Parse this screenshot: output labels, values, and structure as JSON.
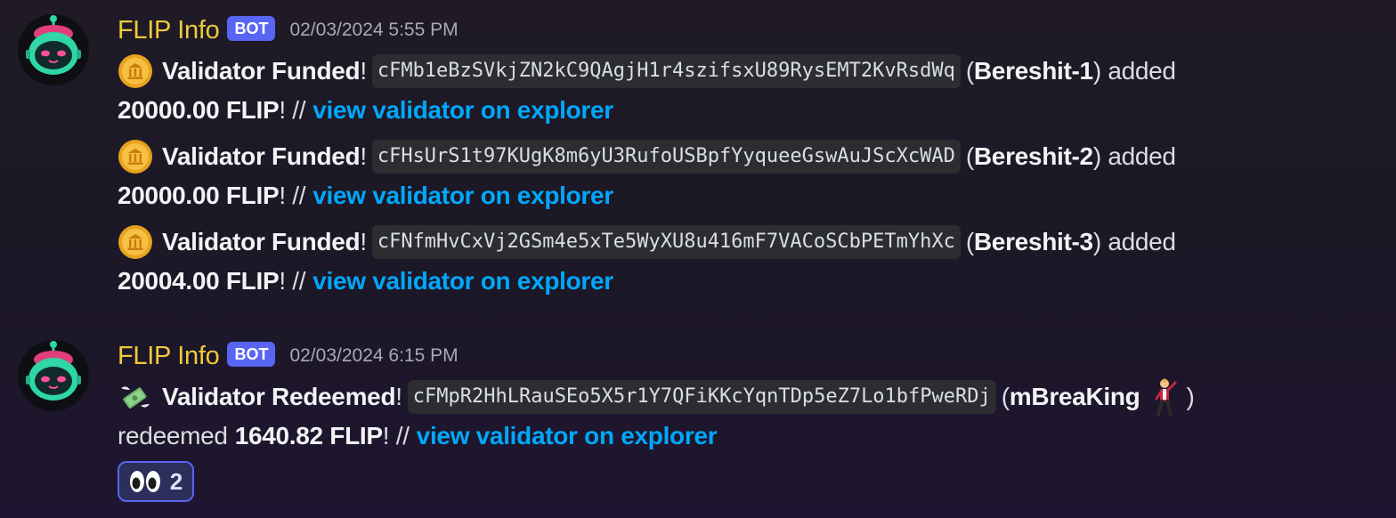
{
  "messages": [
    {
      "author": "FLIP Info",
      "bot_tag": "BOT",
      "timestamp": "02/03/2024 5:55 PM",
      "avatar_icon": "robot-avatar-icon",
      "entries": [
        {
          "icon": "coin-emoji-icon",
          "title": "Validator Funded",
          "bang": "!",
          "address": "cFMb1eBzSVkjZN2kC9QAgjH1r4szifsxU89RysEMT2KvRsdWq",
          "open_paren": "(",
          "name": "Bereshit-1",
          "close_text": ") added",
          "amount": "20000.00 FLIP",
          "sep": "! //",
          "link": "view validator on explorer"
        },
        {
          "icon": "coin-emoji-icon",
          "title": "Validator Funded",
          "bang": "!",
          "address": "cFHsUrS1t97KUgK8m6yU3RufoUSBpfYyqueeGswAuJScXcWAD",
          "open_paren": "(",
          "name": "Bereshit-2",
          "close_text": ") added",
          "amount": "20000.00 FLIP",
          "sep": "! //",
          "link": "view validator on explorer"
        },
        {
          "icon": "coin-emoji-icon",
          "title": "Validator Funded",
          "bang": "!",
          "address": "cFNfmHvCxVj2GSm4e5xTe5WyXU8u416mF7VACoSCbPETmYhXc",
          "open_paren": "(",
          "name": "Bereshit-3",
          "close_text": ") added",
          "amount": "20004.00 FLIP",
          "sep": "! //",
          "link": "view validator on explorer"
        }
      ]
    },
    {
      "author": "FLIP Info",
      "bot_tag": "BOT",
      "timestamp": "02/03/2024 6:15 PM",
      "avatar_icon": "robot-avatar-icon",
      "entries": [
        {
          "icon": "money-with-wings-emoji-icon",
          "title": "Validator Redeemed",
          "bang": "!",
          "address": "cFMpR2HhLRauSEo5X5r1Y7QFiKKcYqnTDp5eZ7Lo1bfPweRDj",
          "open_paren": "(",
          "name": "mBreaKing",
          "name_icon": "dancing-man-emoji-icon",
          "close_text": ")",
          "pre_amount": "redeemed",
          "amount": "1640.82 FLIP",
          "sep": "! //",
          "link": "view validator on explorer"
        }
      ],
      "reaction": {
        "emoji": "eyes-emoji-icon",
        "count": "2"
      }
    }
  ],
  "colors": {
    "username": "#f0c93a",
    "bot_tag": "#5865f2",
    "link": "#00a8fc",
    "code_bg": "#2b2d31"
  }
}
